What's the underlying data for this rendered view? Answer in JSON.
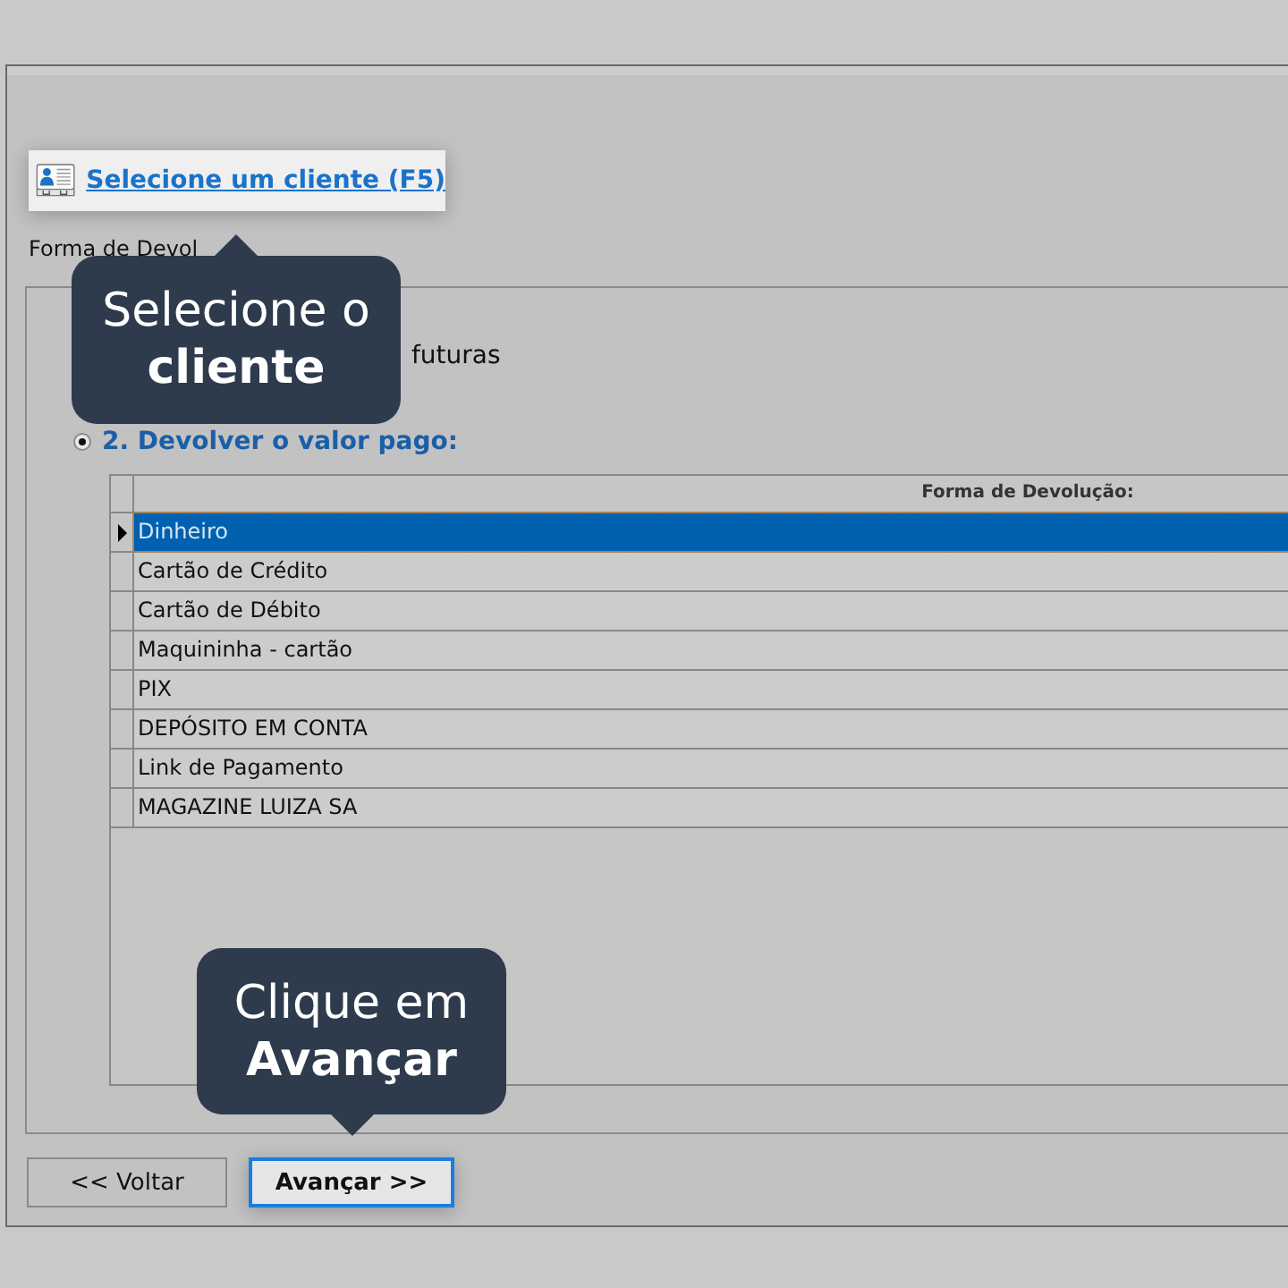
{
  "client_link": {
    "label": "Selecione um cliente (F5)"
  },
  "group_label": "Forma de Devol",
  "option_1_fragment": "futuras",
  "option_2": {
    "label": "2. Devolver o valor pago:",
    "selected": true
  },
  "grid": {
    "columns": [
      "Forma de Devolução:"
    ],
    "rows": [
      {
        "label": "Dinheiro",
        "selected": true
      },
      {
        "label": "Cartão de Crédito",
        "selected": false
      },
      {
        "label": "Cartão de Débito",
        "selected": false
      },
      {
        "label": "Maquininha - cartão",
        "selected": false
      },
      {
        "label": "PIX",
        "selected": false
      },
      {
        "label": "DEPÓSITO EM CONTA",
        "selected": false
      },
      {
        "label": "Link de Pagamento",
        "selected": false
      },
      {
        "label": "MAGAZINE LUIZA SA",
        "selected": false
      }
    ]
  },
  "buttons": [
    {
      "label": "<< Voltar",
      "focused": false
    },
    {
      "label": "Avançar >>",
      "focused": true
    }
  ],
  "tooltips": [
    {
      "text": "Selecione o",
      "bold": "cliente"
    },
    {
      "text": "Clique em",
      "bold": "Avançar"
    }
  ]
}
